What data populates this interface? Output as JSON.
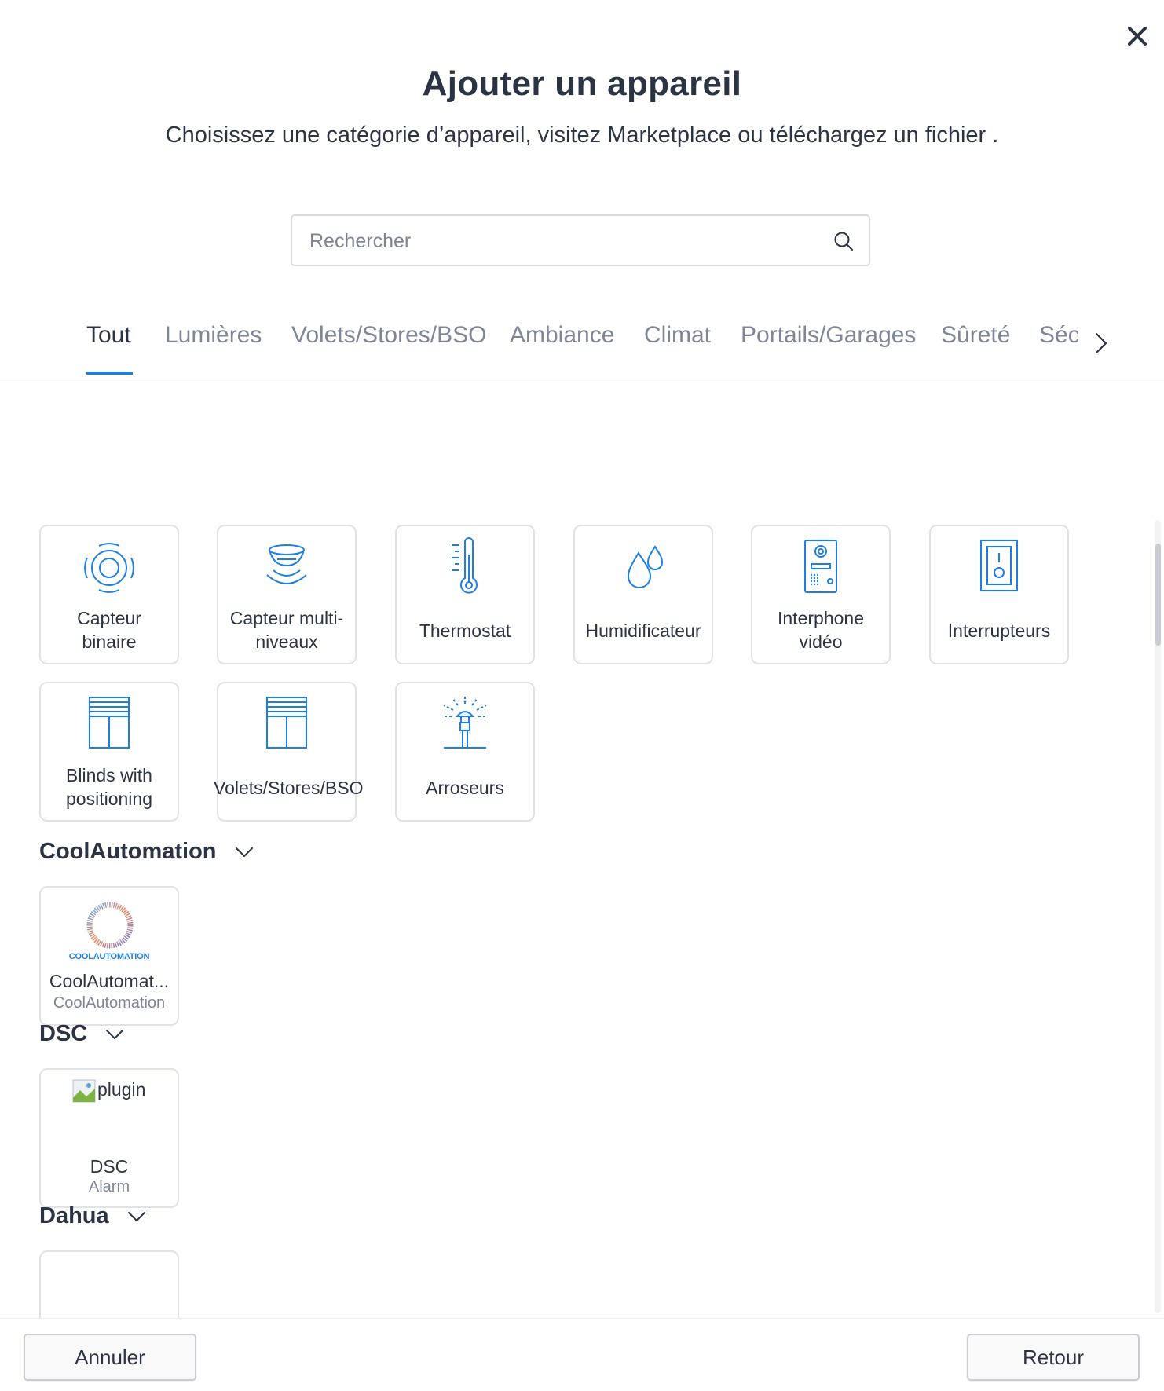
{
  "dialog": {
    "title": "Ajouter un appareil",
    "subtitle": "Choisissez une catégorie d’appareil, visitez Marketplace ou téléchargez un fichier ."
  },
  "search": {
    "placeholder": "Rechercher",
    "value": ""
  },
  "tabs": [
    {
      "label": "Tout",
      "active": true
    },
    {
      "label": "Lumières"
    },
    {
      "label": "Volets/Stores/BSO"
    },
    {
      "label": "Ambiance"
    },
    {
      "label": "Climat"
    },
    {
      "label": "Portails/Garages"
    },
    {
      "label": "Sûreté"
    },
    {
      "label": "Séc"
    }
  ],
  "categories": [
    {
      "line1": "Capteur",
      "line2": "binaire",
      "icon": "binary-sensor-icon"
    },
    {
      "line1": "Capteur multi-",
      "line2": "niveaux",
      "icon": "multilevel-sensor-icon"
    },
    {
      "label": "Thermostat",
      "icon": "thermometer-icon"
    },
    {
      "label": "Humidificateur",
      "icon": "droplets-icon"
    },
    {
      "line1": "Interphone",
      "line2": "vidéo",
      "icon": "intercom-icon"
    },
    {
      "label": "Interrupteurs",
      "icon": "switch-icon"
    },
    {
      "line1": "Blinds with",
      "line2": "positioning",
      "icon": "blinds-icon"
    },
    {
      "label": "Volets/Stores/BSO",
      "icon": "blinds-icon"
    },
    {
      "label": "Arroseurs",
      "icon": "sprinkler-icon"
    }
  ],
  "sections": [
    {
      "title": "CoolAutomation",
      "plugins": [
        {
          "name": "CoolAutomat...",
          "vendor": "CoolAutomation",
          "logo_text": "COOLAUTOMATION"
        }
      ]
    },
    {
      "title": "DSC",
      "plugins": [
        {
          "name": "DSC",
          "vendor": "Alarm",
          "image_alt": "plugin"
        }
      ]
    },
    {
      "title": "Dahua"
    }
  ],
  "footer": {
    "cancel": "Annuler",
    "back": "Retour"
  },
  "colors": {
    "accent": "#1f7fe0",
    "text": "#2b3442",
    "muted": "#7f8796",
    "border": "#dfe2e6"
  }
}
